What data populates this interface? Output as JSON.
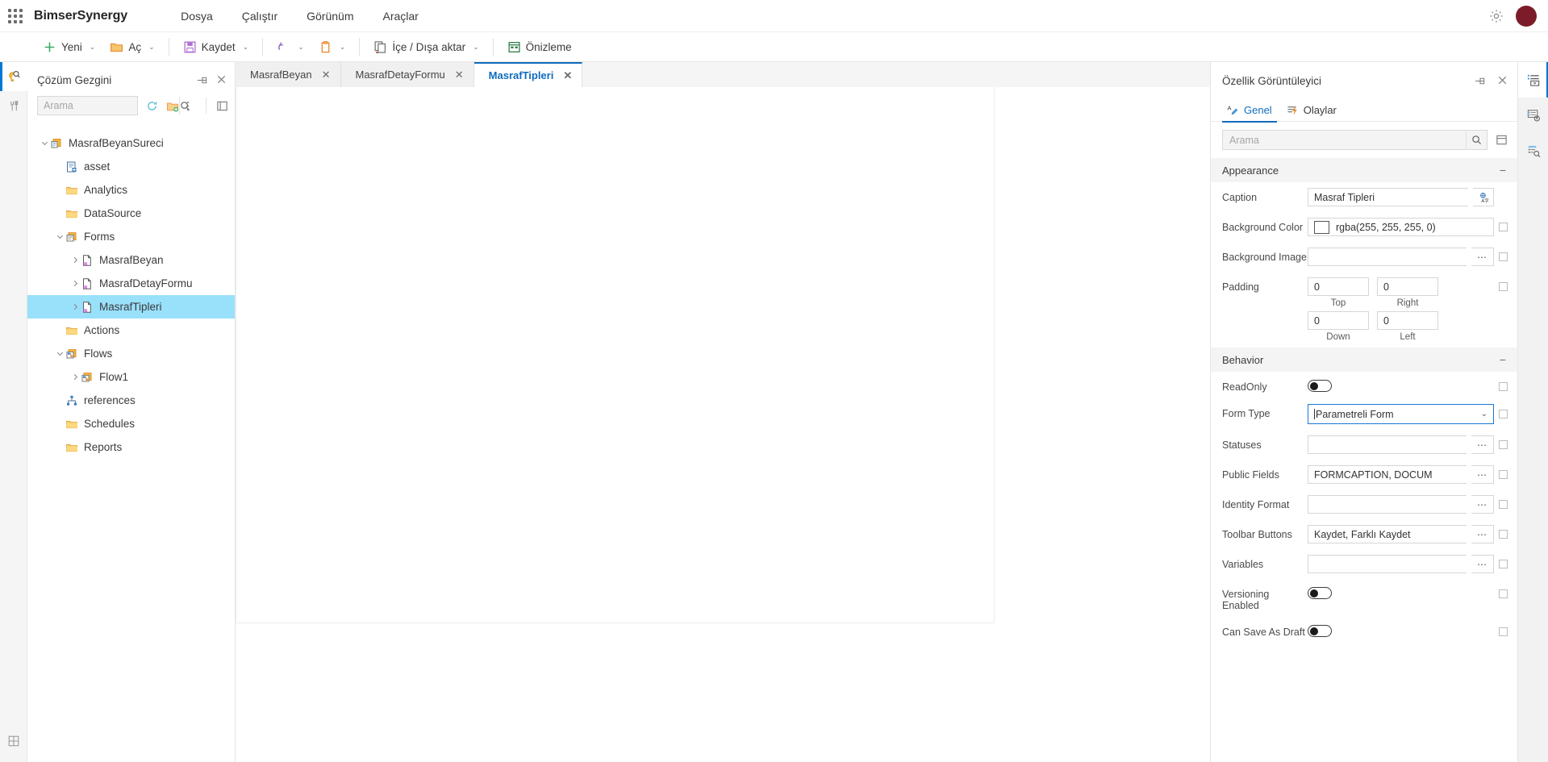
{
  "topbar": {
    "brand": "BimserSynergy",
    "waffle_icon": "app-grid-icon",
    "menus": [
      {
        "label": "Dosya"
      },
      {
        "label": "Çalıştır"
      },
      {
        "label": "Görünüm"
      },
      {
        "label": "Araçlar"
      }
    ],
    "settings_icon": "gear-icon",
    "avatar": "user-avatar",
    "avatar_color": "#7c1c2b"
  },
  "ribbon": {
    "items": [
      {
        "label": "Yeni",
        "icon": "plus-icon",
        "caret": "⌄",
        "color": "#3aaa65"
      },
      {
        "label": "Aç",
        "icon": "folder-open-icon",
        "caret": "⌄",
        "color": "#e8862a"
      },
      {
        "label": "Kaydet",
        "icon": "save-floppy-icon",
        "caret": "⌄",
        "color": "#b06fd0"
      },
      {
        "label": "",
        "icon": "undo-icon",
        "caret": "⌄",
        "color": "#8a5fc8"
      },
      {
        "label": "",
        "icon": "clipboard-icon",
        "caret": "⌄",
        "color": "#e8862a"
      },
      {
        "label": "İçe / Dışa aktar",
        "icon": "import-export-icon",
        "caret": "⌄",
        "color": "#5a5a5a"
      },
      {
        "label": "Önizleme",
        "icon": "preview-icon",
        "caret": "",
        "color": "#2d7d46"
      }
    ]
  },
  "left_rail": {
    "items": [
      {
        "name": "solution-explorer-rail-icon",
        "active": true
      },
      {
        "name": "tools-rail-icon",
        "active": false
      }
    ],
    "bottom": [
      {
        "name": "extensions-rail-icon",
        "active": false
      }
    ]
  },
  "explorer": {
    "title": "Çözüm Gezgini",
    "pin_icon": "pin-icon",
    "close_icon": "close-icon",
    "search": {
      "placeholder": "Arama",
      "value": ""
    },
    "search_icon": "search-icon",
    "toolbar": [
      {
        "name": "refresh-icon"
      },
      {
        "name": "add-folder-icon"
      },
      {
        "name": "more-options-icon"
      },
      {
        "name": "collapse-all-icon"
      }
    ],
    "tree": [
      {
        "label": "MasrafBeyanSureci",
        "indent": 0,
        "chevron": "down",
        "icon": "solution-icon",
        "selected": false
      },
      {
        "label": "asset",
        "indent": 1,
        "chevron": "",
        "icon": "asset-icon",
        "selected": false
      },
      {
        "label": "Analytics",
        "indent": 1,
        "chevron": "",
        "icon": "folder-icon",
        "selected": false
      },
      {
        "label": "DataSource",
        "indent": 1,
        "chevron": "",
        "icon": "folder-icon",
        "selected": false
      },
      {
        "label": "Forms",
        "indent": 1,
        "chevron": "down",
        "icon": "forms-folder-icon",
        "selected": false
      },
      {
        "label": "MasrafBeyan",
        "indent": 2,
        "chevron": "right",
        "icon": "form-file-icon",
        "selected": false
      },
      {
        "label": "MasrafDetayFormu",
        "indent": 2,
        "chevron": "right",
        "icon": "form-file-icon",
        "selected": false
      },
      {
        "label": "MasrafTipleri",
        "indent": 2,
        "chevron": "right",
        "icon": "form-file-icon",
        "selected": true
      },
      {
        "label": "Actions",
        "indent": 1,
        "chevron": "",
        "icon": "folder-icon",
        "selected": false
      },
      {
        "label": "Flows",
        "indent": 1,
        "chevron": "down",
        "icon": "flows-folder-icon",
        "selected": false
      },
      {
        "label": "Flow1",
        "indent": 2,
        "chevron": "right",
        "icon": "flow-icon",
        "selected": false
      },
      {
        "label": "references",
        "indent": 1,
        "chevron": "",
        "icon": "references-icon",
        "selected": false
      },
      {
        "label": "Schedules",
        "indent": 1,
        "chevron": "",
        "icon": "folder-icon",
        "selected": false
      },
      {
        "label": "Reports",
        "indent": 1,
        "chevron": "",
        "icon": "folder-icon",
        "selected": false
      }
    ]
  },
  "tabs": [
    {
      "label": "MasrafBeyan",
      "active": false,
      "close": "✕"
    },
    {
      "label": "MasrafDetayFormu",
      "active": false,
      "close": "✕"
    },
    {
      "label": "MasrafTipleri",
      "active": true,
      "close": "✕"
    }
  ],
  "properties": {
    "title": "Özellik Görüntüleyici",
    "pin_icon": "pin-icon",
    "close_icon": "close-icon",
    "tabs": [
      {
        "label": "Genel",
        "icon": "properties-icon",
        "active": true
      },
      {
        "label": "Olaylar",
        "icon": "events-icon",
        "active": false
      }
    ],
    "search": {
      "placeholder": "Arama",
      "value": ""
    },
    "search_icon": "search-icon",
    "collapse_all_icon": "collapse-all-icon",
    "groups": [
      {
        "title": "Appearance",
        "collapse": "−",
        "rows": [
          {
            "label": "Caption",
            "type": "text-globe",
            "value": "Masraf Tipleri",
            "globe_icon": "translate-icon"
          },
          {
            "label": "Background Color",
            "type": "color",
            "value": "rgba(255, 255, 255, 0)",
            "swatch": "#ffffff"
          },
          {
            "label": "Background Image",
            "type": "text-dots",
            "value": "",
            "dots": "⋯"
          },
          {
            "label": "Padding",
            "type": "padding",
            "cells": [
              {
                "value": "0",
                "caption": "Top"
              },
              {
                "value": "0",
                "caption": "Right"
              },
              {
                "value": "0",
                "caption": "Down"
              },
              {
                "value": "0",
                "caption": "Left"
              }
            ]
          }
        ]
      },
      {
        "title": "Behavior",
        "collapse": "−",
        "rows": [
          {
            "label": "ReadOnly",
            "type": "toggle",
            "value": "off"
          },
          {
            "label": "Form Type",
            "type": "combo",
            "value": "Parametreli Form",
            "focused": true,
            "caret": "⌄"
          },
          {
            "label": "Statuses",
            "type": "text-dots",
            "value": "",
            "dots": "⋯"
          },
          {
            "label": "Public Fields",
            "type": "text-dots",
            "value": "FORMCAPTION, DOCUM",
            "dots": "⋯"
          },
          {
            "label": "Identity Format",
            "type": "text-dots",
            "value": "",
            "dots": "⋯"
          },
          {
            "label": "Toolbar Buttons",
            "type": "text-dots",
            "value": "Kaydet, Farklı Kaydet",
            "dots": "⋯"
          },
          {
            "label": "Variables",
            "type": "text-dots",
            "value": "",
            "dots": "⋯"
          },
          {
            "label": "Versioning Enabled",
            "type": "toggle",
            "value": "off"
          },
          {
            "label": "Can Save As Draft",
            "type": "toggle",
            "value": "off"
          }
        ]
      }
    ]
  },
  "right_rail": {
    "items": [
      {
        "name": "property-viewer-rail-icon",
        "active": true
      },
      {
        "name": "settings-list-rail-icon",
        "active": false
      },
      {
        "name": "inspector-rail-icon",
        "active": false
      }
    ]
  }
}
